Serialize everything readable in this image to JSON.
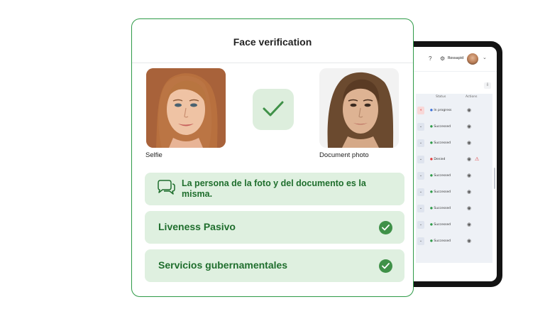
{
  "header": {
    "title": "Face verification"
  },
  "photos": {
    "selfie_label": "Selfie",
    "document_label": "Document photo",
    "match_icon": "check-icon"
  },
  "results": [
    {
      "text": "La persona de la foto y del documento es la misma.",
      "icon": "chat-bubbles-icon"
    },
    {
      "label": "Liveness Pasivo",
      "status_icon": "check-circle-icon"
    },
    {
      "label": "Servicios gubernamentales",
      "status_icon": "check-circle-icon"
    }
  ],
  "background_app": {
    "user_name": "Rossapid",
    "column_status": "Status",
    "column_actions": "Actions",
    "rows": [
      {
        "status": "In progress",
        "status_color": "#3a6fd8"
      },
      {
        "status": "Successed",
        "status_color": "#2e9a47"
      },
      {
        "status": "Successed",
        "status_color": "#2e9a47"
      },
      {
        "status": "Denied",
        "status_color": "#e03b3b"
      },
      {
        "status": "Successed",
        "status_color": "#2e9a47"
      },
      {
        "status": "Successed",
        "status_color": "#2e9a47"
      },
      {
        "status": "Successed",
        "status_color": "#2e9a47"
      },
      {
        "status": "Successed",
        "status_color": "#2e9a47"
      },
      {
        "status": "Successed",
        "status_color": "#2e9a47"
      }
    ]
  },
  "colors": {
    "accent": "#2e9a47",
    "result_bg": "#dff0e0",
    "result_text": "#1f6e2d"
  }
}
